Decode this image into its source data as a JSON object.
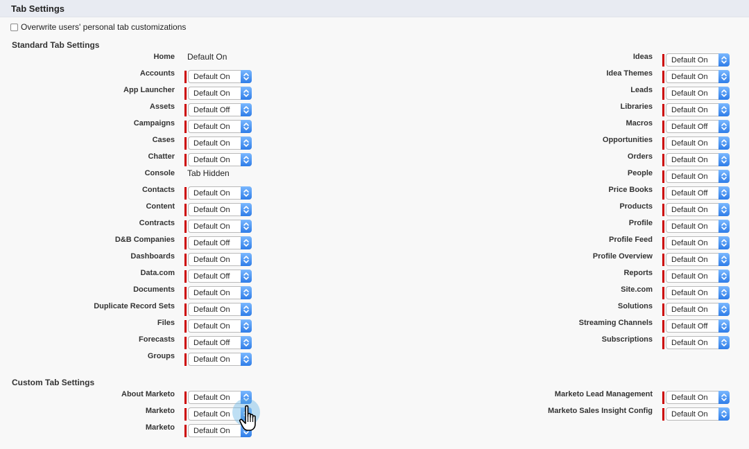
{
  "header": {
    "title": "Tab Settings"
  },
  "overwrite": {
    "label": "Overwrite users' personal tab customizations",
    "checked": false
  },
  "standard": {
    "title": "Standard Tab Settings",
    "left": [
      {
        "label": "Home",
        "value": "Default On",
        "type": "static"
      },
      {
        "label": "Accounts",
        "value": "Default On",
        "type": "select"
      },
      {
        "label": "App Launcher",
        "value": "Default On",
        "type": "select"
      },
      {
        "label": "Assets",
        "value": "Default Off",
        "type": "select"
      },
      {
        "label": "Campaigns",
        "value": "Default On",
        "type": "select"
      },
      {
        "label": "Cases",
        "value": "Default On",
        "type": "select"
      },
      {
        "label": "Chatter",
        "value": "Default On",
        "type": "select"
      },
      {
        "label": "Console",
        "value": "Tab Hidden",
        "type": "static"
      },
      {
        "label": "Contacts",
        "value": "Default On",
        "type": "select"
      },
      {
        "label": "Content",
        "value": "Default On",
        "type": "select"
      },
      {
        "label": "Contracts",
        "value": "Default On",
        "type": "select"
      },
      {
        "label": "D&B Companies",
        "value": "Default Off",
        "type": "select"
      },
      {
        "label": "Dashboards",
        "value": "Default On",
        "type": "select"
      },
      {
        "label": "Data.com",
        "value": "Default Off",
        "type": "select"
      },
      {
        "label": "Documents",
        "value": "Default On",
        "type": "select"
      },
      {
        "label": "Duplicate Record Sets",
        "value": "Default On",
        "type": "select"
      },
      {
        "label": "Files",
        "value": "Default On",
        "type": "select"
      },
      {
        "label": "Forecasts",
        "value": "Default Off",
        "type": "select"
      },
      {
        "label": "Groups",
        "value": "Default On",
        "type": "select"
      }
    ],
    "right": [
      {
        "label": "Ideas",
        "value": "Default On",
        "type": "select"
      },
      {
        "label": "Idea Themes",
        "value": "Default On",
        "type": "select"
      },
      {
        "label": "Leads",
        "value": "Default On",
        "type": "select"
      },
      {
        "label": "Libraries",
        "value": "Default On",
        "type": "select"
      },
      {
        "label": "Macros",
        "value": "Default Off",
        "type": "select"
      },
      {
        "label": "Opportunities",
        "value": "Default On",
        "type": "select"
      },
      {
        "label": "Orders",
        "value": "Default On",
        "type": "select"
      },
      {
        "label": "People",
        "value": "Default On",
        "type": "select"
      },
      {
        "label": "Price Books",
        "value": "Default Off",
        "type": "select"
      },
      {
        "label": "Products",
        "value": "Default On",
        "type": "select"
      },
      {
        "label": "Profile",
        "value": "Default On",
        "type": "select"
      },
      {
        "label": "Profile Feed",
        "value": "Default On",
        "type": "select"
      },
      {
        "label": "Profile Overview",
        "value": "Default On",
        "type": "select"
      },
      {
        "label": "Reports",
        "value": "Default On",
        "type": "select"
      },
      {
        "label": "Site.com",
        "value": "Default On",
        "type": "select"
      },
      {
        "label": "Solutions",
        "value": "Default On",
        "type": "select"
      },
      {
        "label": "Streaming Channels",
        "value": "Default Off",
        "type": "select"
      },
      {
        "label": "Subscriptions",
        "value": "Default On",
        "type": "select"
      }
    ]
  },
  "custom": {
    "title": "Custom Tab Settings",
    "left": [
      {
        "label": "About Marketo",
        "value": "Default On",
        "type": "select"
      },
      {
        "label": "Marketo",
        "value": "Default On",
        "type": "select"
      },
      {
        "label": "Marketo",
        "value": "Default On",
        "type": "select"
      }
    ],
    "right": [
      {
        "label": "Marketo Lead Management",
        "value": "Default On",
        "type": "select"
      },
      {
        "label": "Marketo Sales Insight Config",
        "value": "Default On",
        "type": "select"
      }
    ]
  },
  "colors": {
    "required": "#cc0000",
    "select_button": "#2f7de8",
    "header_bg": "#e8ebf2"
  },
  "icons": {
    "select_arrows": "up-down-chevron-icon",
    "cursor": "hand-pointer-icon",
    "checkbox": "checkbox-unchecked-icon"
  }
}
